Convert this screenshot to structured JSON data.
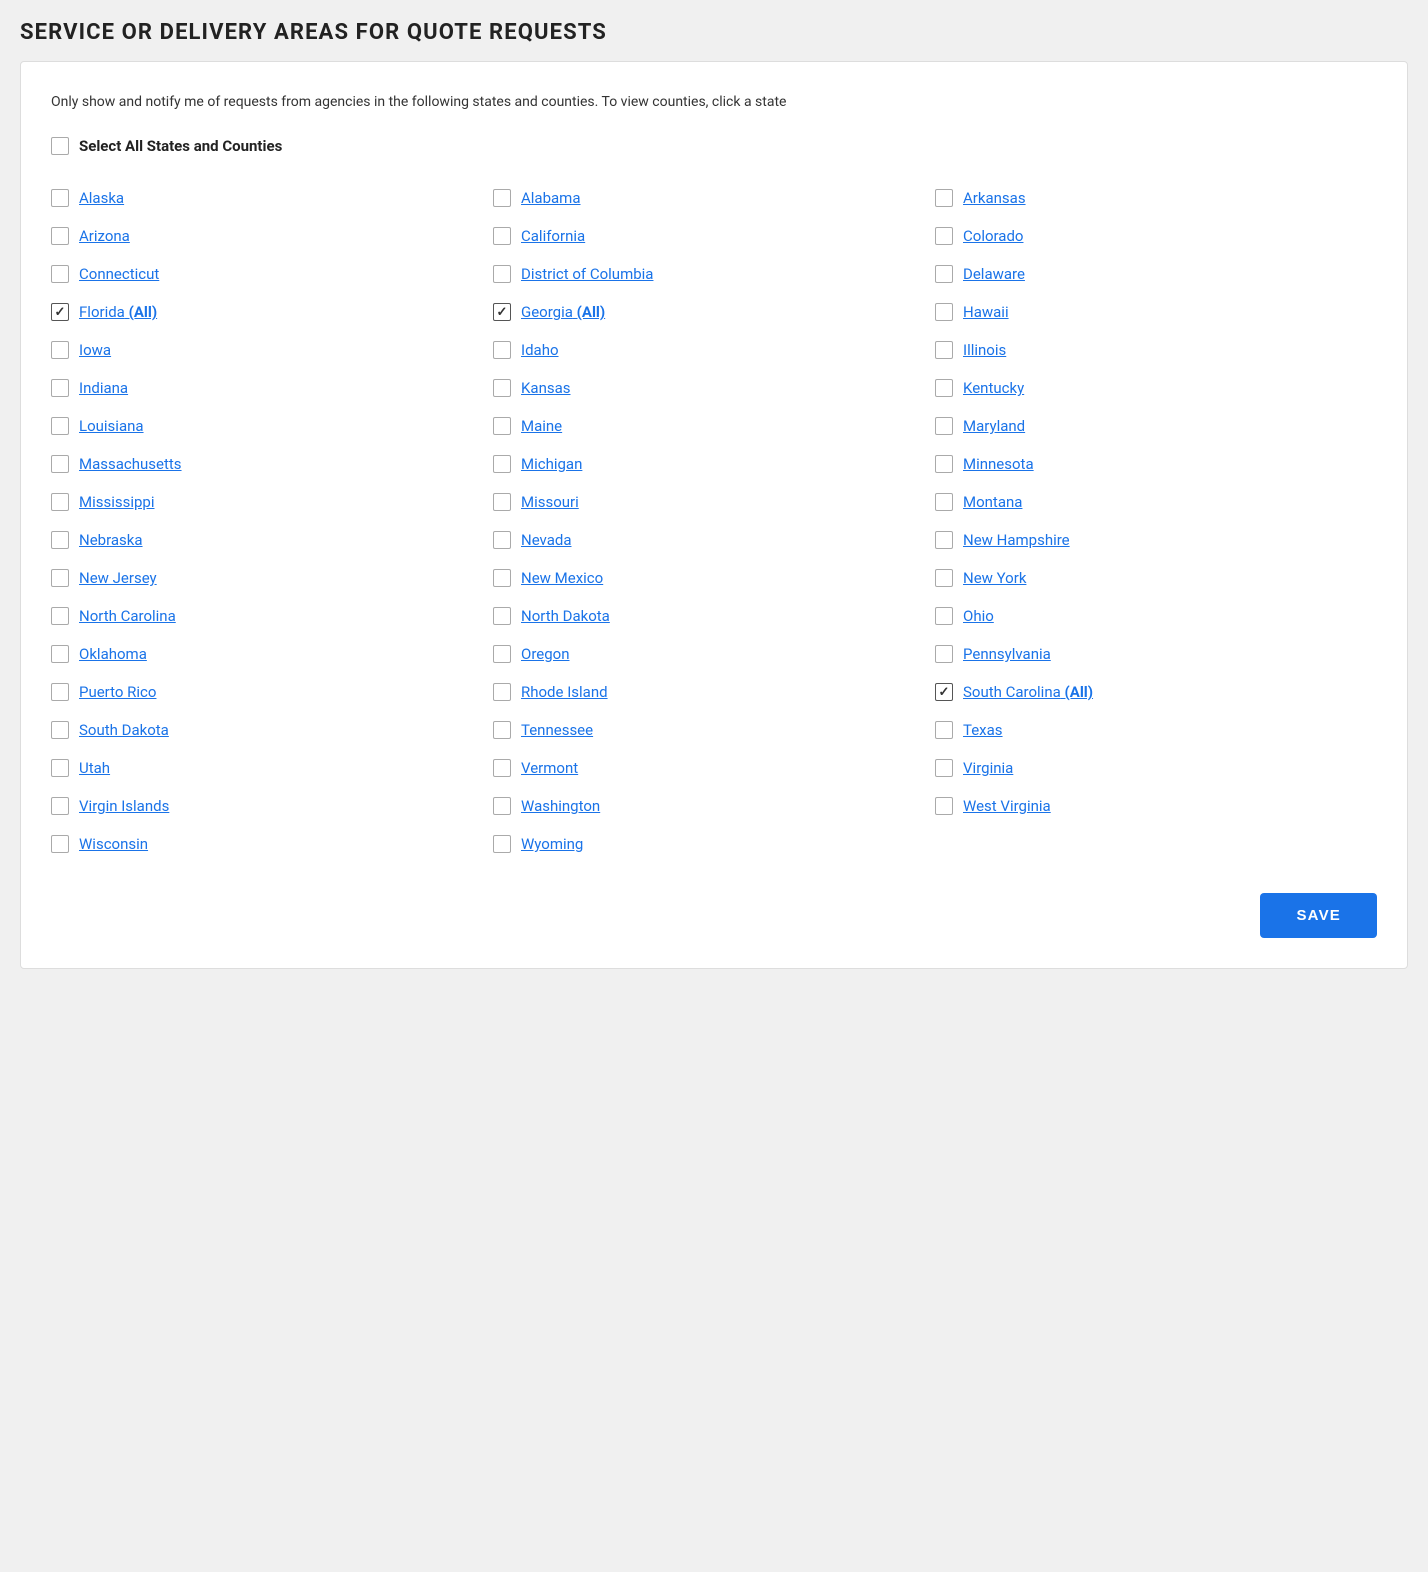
{
  "page": {
    "title": "SERVICE OR DELIVERY AREAS FOR QUOTE REQUESTS",
    "description": "Only show and notify me of requests from agencies in the following states and counties. To view counties, click a state",
    "select_all_label": "Select All States and Counties",
    "save_label": "SAVE"
  },
  "states": [
    {
      "id": "alaska",
      "label": "Alaska",
      "suffix": "",
      "checked": false,
      "col": 0
    },
    {
      "id": "alabama",
      "label": "Alabama",
      "suffix": "",
      "checked": false,
      "col": 1
    },
    {
      "id": "arkansas",
      "label": "Arkansas",
      "suffix": "",
      "checked": false,
      "col": 2
    },
    {
      "id": "arizona",
      "label": "Arizona",
      "suffix": "",
      "checked": false,
      "col": 0
    },
    {
      "id": "california",
      "label": "California",
      "suffix": "",
      "checked": false,
      "col": 1
    },
    {
      "id": "colorado",
      "label": "Colorado",
      "suffix": "",
      "checked": false,
      "col": 2
    },
    {
      "id": "connecticut",
      "label": "Connecticut",
      "suffix": "",
      "checked": false,
      "col": 0
    },
    {
      "id": "dc",
      "label": "District of Columbia",
      "suffix": "",
      "checked": false,
      "col": 1
    },
    {
      "id": "delaware",
      "label": "Delaware",
      "suffix": "",
      "checked": false,
      "col": 2
    },
    {
      "id": "florida",
      "label": "Florida",
      "suffix": " (All)",
      "checked": true,
      "col": 0
    },
    {
      "id": "georgia",
      "label": "Georgia",
      "suffix": " (All)",
      "checked": true,
      "col": 1
    },
    {
      "id": "hawaii",
      "label": "Hawaii",
      "suffix": "",
      "checked": false,
      "col": 2
    },
    {
      "id": "iowa",
      "label": "Iowa",
      "suffix": "",
      "checked": false,
      "col": 0
    },
    {
      "id": "idaho",
      "label": "Idaho",
      "suffix": "",
      "checked": false,
      "col": 1
    },
    {
      "id": "illinois",
      "label": "Illinois",
      "suffix": "",
      "checked": false,
      "col": 2
    },
    {
      "id": "indiana",
      "label": "Indiana",
      "suffix": "",
      "checked": false,
      "col": 0
    },
    {
      "id": "kansas",
      "label": "Kansas",
      "suffix": "",
      "checked": false,
      "col": 1
    },
    {
      "id": "kentucky",
      "label": "Kentucky",
      "suffix": "",
      "checked": false,
      "col": 2
    },
    {
      "id": "louisiana",
      "label": "Louisiana",
      "suffix": "",
      "checked": false,
      "col": 0
    },
    {
      "id": "maine",
      "label": "Maine",
      "suffix": "",
      "checked": false,
      "col": 1
    },
    {
      "id": "maryland",
      "label": "Maryland",
      "suffix": "",
      "checked": false,
      "col": 2
    },
    {
      "id": "massachusetts",
      "label": "Massachusetts",
      "suffix": "",
      "checked": false,
      "col": 0
    },
    {
      "id": "michigan",
      "label": "Michigan",
      "suffix": "",
      "checked": false,
      "col": 1
    },
    {
      "id": "minnesota",
      "label": "Minnesota",
      "suffix": "",
      "checked": false,
      "col": 2
    },
    {
      "id": "mississippi",
      "label": "Mississippi",
      "suffix": "",
      "checked": false,
      "col": 0
    },
    {
      "id": "missouri",
      "label": "Missouri",
      "suffix": "",
      "checked": false,
      "col": 1
    },
    {
      "id": "montana",
      "label": "Montana",
      "suffix": "",
      "checked": false,
      "col": 2
    },
    {
      "id": "nebraska",
      "label": "Nebraska",
      "suffix": "",
      "checked": false,
      "col": 0
    },
    {
      "id": "nevada",
      "label": "Nevada",
      "suffix": "",
      "checked": false,
      "col": 1
    },
    {
      "id": "new_hampshire",
      "label": "New Hampshire",
      "suffix": "",
      "checked": false,
      "col": 2
    },
    {
      "id": "new_jersey",
      "label": "New Jersey",
      "suffix": "",
      "checked": false,
      "col": 0
    },
    {
      "id": "new_mexico",
      "label": "New Mexico",
      "suffix": "",
      "checked": false,
      "col": 1
    },
    {
      "id": "new_york",
      "label": "New York",
      "suffix": "",
      "checked": false,
      "col": 2
    },
    {
      "id": "north_carolina",
      "label": "North Carolina",
      "suffix": "",
      "checked": false,
      "col": 0
    },
    {
      "id": "north_dakota",
      "label": "North Dakota",
      "suffix": "",
      "checked": false,
      "col": 1
    },
    {
      "id": "ohio",
      "label": "Ohio",
      "suffix": "",
      "checked": false,
      "col": 2
    },
    {
      "id": "oklahoma",
      "label": "Oklahoma",
      "suffix": "",
      "checked": false,
      "col": 0
    },
    {
      "id": "oregon",
      "label": "Oregon",
      "suffix": "",
      "checked": false,
      "col": 1
    },
    {
      "id": "pennsylvania",
      "label": "Pennsylvania",
      "suffix": "",
      "checked": false,
      "col": 2
    },
    {
      "id": "puerto_rico",
      "label": "Puerto Rico",
      "suffix": "",
      "checked": false,
      "col": 0
    },
    {
      "id": "rhode_island",
      "label": "Rhode Island",
      "suffix": "",
      "checked": false,
      "col": 1
    },
    {
      "id": "south_carolina",
      "label": "South Carolina",
      "suffix": " (All)",
      "checked": true,
      "col": 2
    },
    {
      "id": "south_dakota",
      "label": "South Dakota",
      "suffix": "",
      "checked": false,
      "col": 0
    },
    {
      "id": "tennessee",
      "label": "Tennessee",
      "suffix": "",
      "checked": false,
      "col": 1
    },
    {
      "id": "texas",
      "label": "Texas",
      "suffix": "",
      "checked": false,
      "col": 2
    },
    {
      "id": "utah",
      "label": "Utah",
      "suffix": "",
      "checked": false,
      "col": 0
    },
    {
      "id": "vermont",
      "label": "Vermont",
      "suffix": "",
      "checked": false,
      "col": 1
    },
    {
      "id": "virginia",
      "label": "Virginia",
      "suffix": "",
      "checked": false,
      "col": 2
    },
    {
      "id": "virgin_islands",
      "label": "Virgin Islands",
      "suffix": "",
      "checked": false,
      "col": 0
    },
    {
      "id": "washington",
      "label": "Washington",
      "suffix": "",
      "checked": false,
      "col": 1
    },
    {
      "id": "west_virginia",
      "label": "West Virginia",
      "suffix": "",
      "checked": false,
      "col": 2
    },
    {
      "id": "wisconsin",
      "label": "Wisconsin",
      "suffix": "",
      "checked": false,
      "col": 0
    },
    {
      "id": "wyoming",
      "label": "Wyoming",
      "suffix": "",
      "checked": false,
      "col": 1
    }
  ]
}
